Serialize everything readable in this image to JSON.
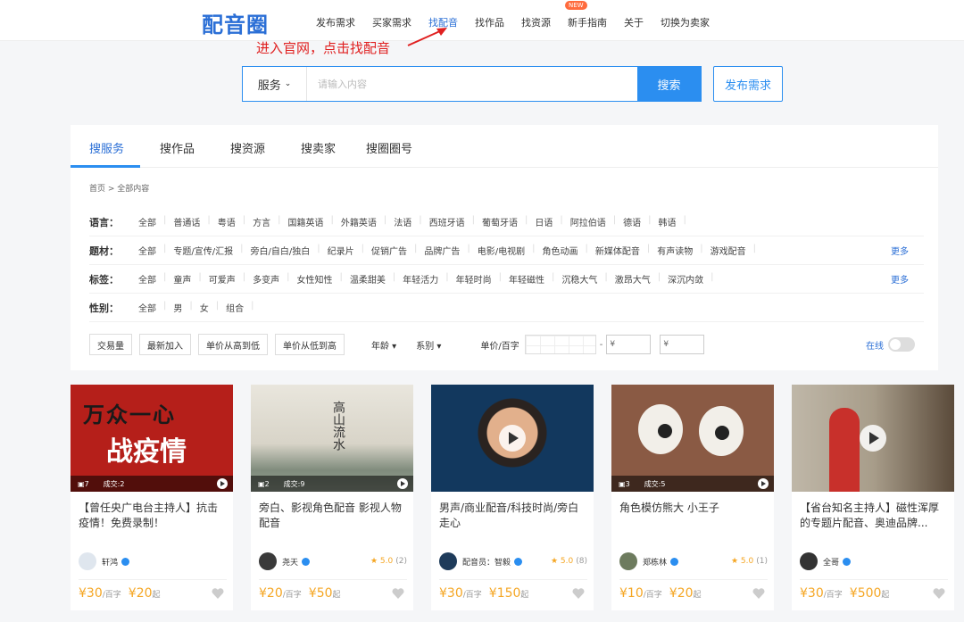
{
  "header": {
    "logo": "配音圈",
    "nav": [
      "发布需求",
      "买家需求",
      "找配音",
      "找作品",
      "找资源",
      "新手指南",
      "关于",
      "切换为卖家"
    ],
    "new_badge": "NEW"
  },
  "annotation": "进入官网，点击找配音",
  "search": {
    "select_value": "服务",
    "placeholder": "请输入内容",
    "button": "搜索",
    "publish": "发布需求"
  },
  "tabs": [
    "搜服务",
    "搜作品",
    "搜资源",
    "搜卖家",
    "搜圈圈号"
  ],
  "breadcrumb": "首页 > 全部内容",
  "filters": {
    "language": {
      "label": "语言：",
      "items": [
        "全部",
        "普通话",
        "粤语",
        "方言",
        "国籍英语",
        "外籍英语",
        "法语",
        "西班牙语",
        "葡萄牙语",
        "日语",
        "阿拉伯语",
        "德语",
        "韩语"
      ]
    },
    "subject": {
      "label": "题材：",
      "items": [
        "全部",
        "专题/宣传/汇报",
        "旁白/自白/独白",
        "纪录片",
        "促销广告",
        "品牌广告",
        "电影/电视剧",
        "角色动画",
        "新媒体配音",
        "有声读物",
        "游戏配音"
      ],
      "more": "更多"
    },
    "tags": {
      "label": "标签：",
      "items": [
        "全部",
        "童声",
        "可爱声",
        "多变声",
        "女性知性",
        "温柔甜美",
        "年轻活力",
        "年轻时尚",
        "年轻磁性",
        "沉稳大气",
        "激昂大气",
        "深沉内敛"
      ],
      "more": "更多"
    },
    "gender": {
      "label": "性别：",
      "items": [
        "全部",
        "男",
        "女",
        "组合"
      ]
    }
  },
  "sortbar": {
    "buttons": [
      "交易量",
      "最新加入",
      "单价从高到低",
      "单价从低到高"
    ],
    "age": "年龄 ▾",
    "series": "系别 ▾",
    "price_label": "单价/百字",
    "currency_from": "¥",
    "currency_to": "¥",
    "dash": "-",
    "online": "在线"
  },
  "cards": [
    {
      "title": "【曾任央广电台主持人】抗击疫情！免费录制！",
      "works": "7",
      "deals": "成交:2",
      "seller": "轩鸿",
      "rating": "",
      "rating_count": "",
      "price1": "¥30",
      "unit1": "/百字",
      "price2": "¥20",
      "unit2": "起",
      "thumb_text": "万众一心\n战疫情"
    },
    {
      "title": "旁白、影视角色配音 影视人物配音",
      "works": "2",
      "deals": "成交:9",
      "seller": "尧天",
      "rating": "★ 5.0",
      "rating_count": "(2)",
      "price1": "¥20",
      "unit1": "/百字",
      "price2": "¥50",
      "unit2": "起",
      "thumb_text": "高山流水"
    },
    {
      "title": "男声/商业配音/科技时尚/旁白走心",
      "works": "",
      "deals": "",
      "seller": "配音员：智毅",
      "rating": "★ 5.0",
      "rating_count": "(8)",
      "price1": "¥30",
      "unit1": "/百字",
      "price2": "¥150",
      "unit2": "起",
      "thumb_text": ""
    },
    {
      "title": "角色模仿熊大 小王子",
      "works": "3",
      "deals": "成交:5",
      "seller": "郑栋林",
      "rating": "★ 5.0",
      "rating_count": "(1)",
      "price1": "¥10",
      "unit1": "/百字",
      "price2": "¥20",
      "unit2": "起",
      "thumb_text": ""
    },
    {
      "title": "【省台知名主持人】磁性浑厚的专题片配音、奥迪品牌...",
      "works": "",
      "deals": "",
      "seller": "全哥",
      "rating": "",
      "rating_count": "",
      "price1": "¥30",
      "unit1": "/百字",
      "price2": "¥500",
      "unit2": "起",
      "thumb_text": ""
    }
  ],
  "colors": {
    "brand": "#2b8ef0",
    "price": "#f5a623",
    "annotation": "#e02020"
  }
}
